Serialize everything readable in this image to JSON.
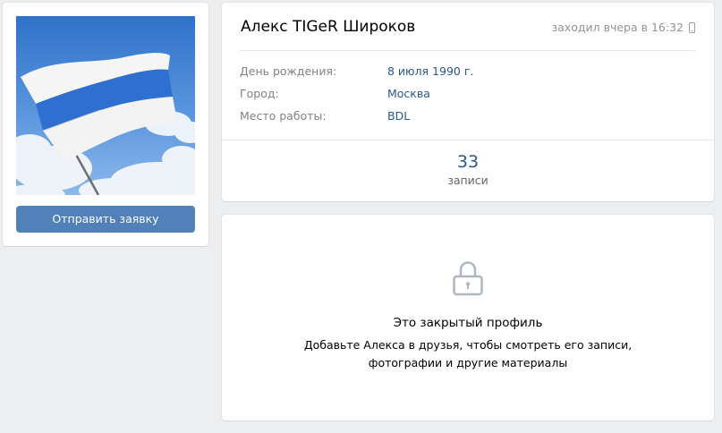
{
  "profile": {
    "name": "Алекс TIGeR Широков",
    "last_seen": "заходил вчера в 16:32",
    "send_request_label": "Отправить заявку",
    "info": [
      {
        "label": "День рождения:",
        "value": "8 июля 1990 г."
      },
      {
        "label": "Город:",
        "value": "Москва"
      },
      {
        "label": "Место работы:",
        "value": "BDL"
      }
    ],
    "counters": {
      "posts_count": "33",
      "posts_label": "записи"
    }
  },
  "private_notice": {
    "title": "Это закрытый профиль",
    "description_line1": "Добавьте Алекса в друзья, чтобы смотреть его записи,",
    "description_line2": "фотографии и другие материалы"
  },
  "icons": {
    "phone": "mobile-phone-icon",
    "lock": "lock-icon"
  },
  "colors": {
    "page_background": "#edeef0",
    "accent": "#5181b8",
    "link": "#2a5885",
    "label": "#828282",
    "muted": "#939393"
  }
}
